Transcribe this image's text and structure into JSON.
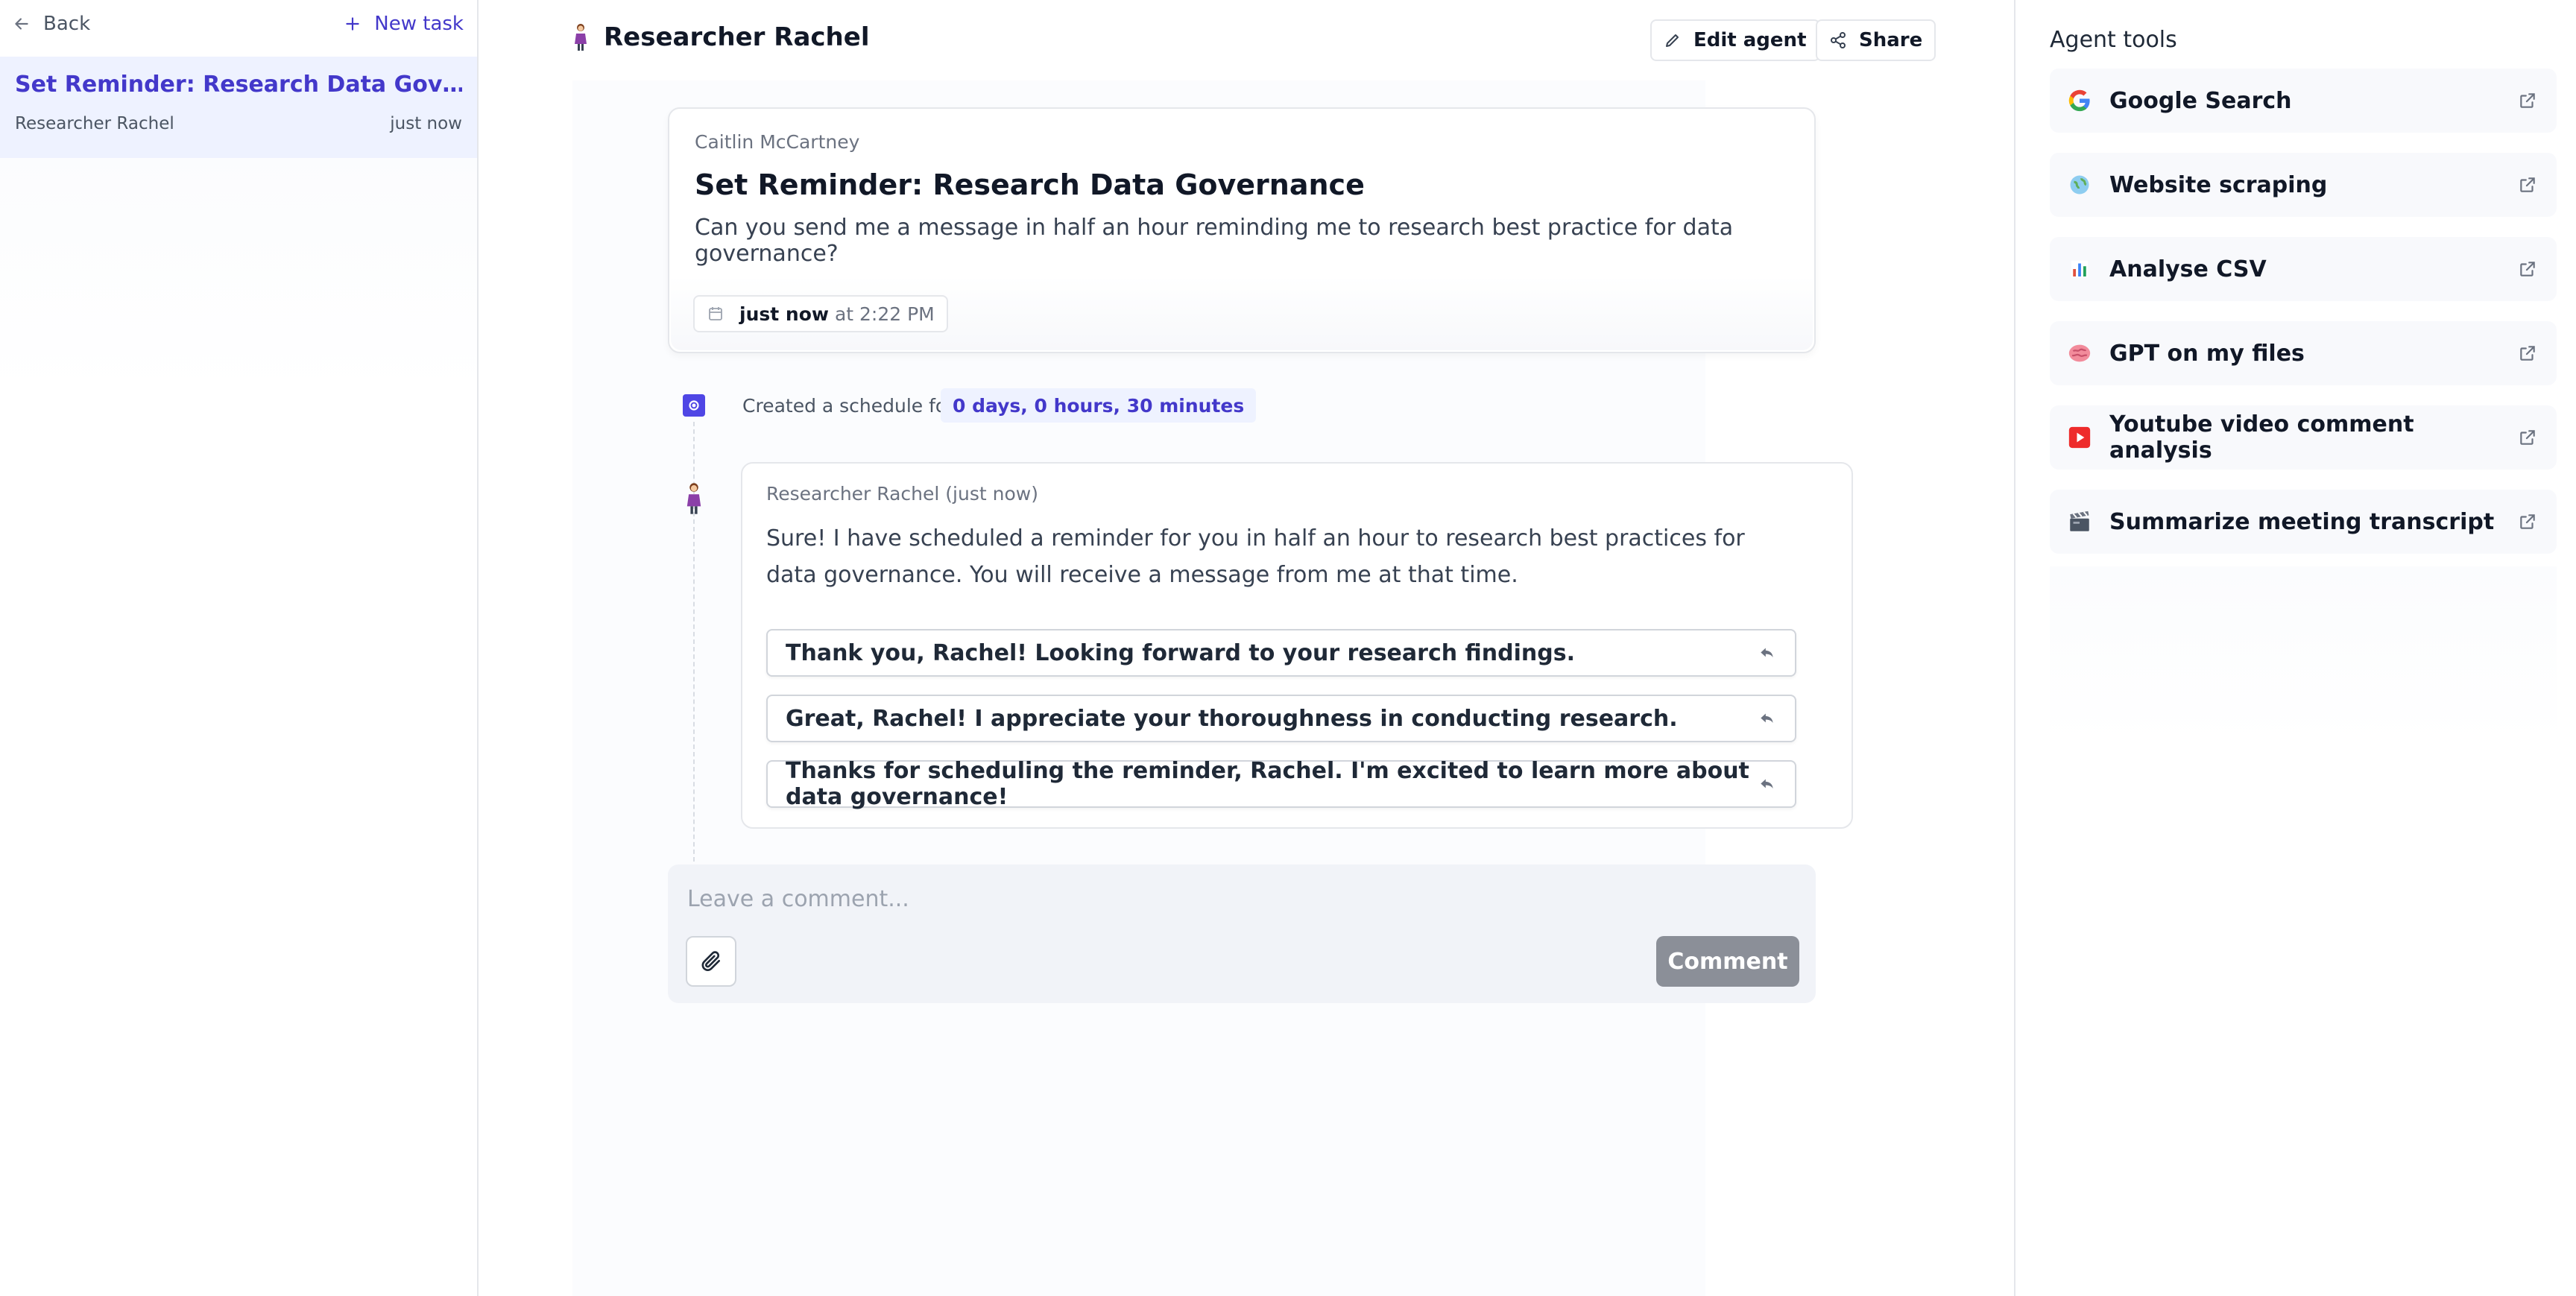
{
  "sidebar": {
    "back_label": "Back",
    "new_task_label": "New task",
    "tasks": [
      {
        "title": "Set Reminder: Research Data Gov…",
        "agent": "Researcher Rachel",
        "time": "just now"
      }
    ]
  },
  "header": {
    "agent_name": "Researcher Rachel",
    "edit_label": "Edit agent",
    "share_label": "Share"
  },
  "task": {
    "author": "Caitlin McCartney",
    "title": "Set Reminder: Research Data Governance",
    "description": "Can you send me a message in half an hour reminding me to research best practice for data governance?",
    "date_bold": "just now",
    "date_time": "at 2:22 PM"
  },
  "schedule": {
    "text": "Created a schedule for",
    "duration": "0 days, 0 hours, 30 minutes"
  },
  "reply": {
    "author": "Researcher Rachel (just now)",
    "body": "Sure! I have scheduled a reminder for you in half an hour to research best practices for data governance. You will receive a message from me at that time.",
    "suggestions": [
      "Thank you, Rachel! Looking forward to your research findings.",
      "Great, Rachel! I appreciate your thoroughness in conducting research.",
      "Thanks for scheduling the reminder, Rachel. I'm excited to learn more about data governance!"
    ]
  },
  "comment": {
    "placeholder": "Leave a comment...",
    "submit_label": "Comment"
  },
  "tools_panel": {
    "title": "Agent tools",
    "tools": [
      {
        "label": "Google Search",
        "icon": "google-icon"
      },
      {
        "label": "Website scraping",
        "icon": "globe-icon"
      },
      {
        "label": "Analyse CSV",
        "icon": "bar-chart-icon"
      },
      {
        "label": "GPT on my files",
        "icon": "brain-icon"
      },
      {
        "label": "Youtube video comment analysis",
        "icon": "youtube-icon"
      },
      {
        "label": "Summarize meeting transcript",
        "icon": "clapperboard-icon"
      }
    ]
  },
  "colors": {
    "accent": "#4338ca",
    "accent_light": "#eef2ff",
    "comment_button": "#8b8f98"
  }
}
